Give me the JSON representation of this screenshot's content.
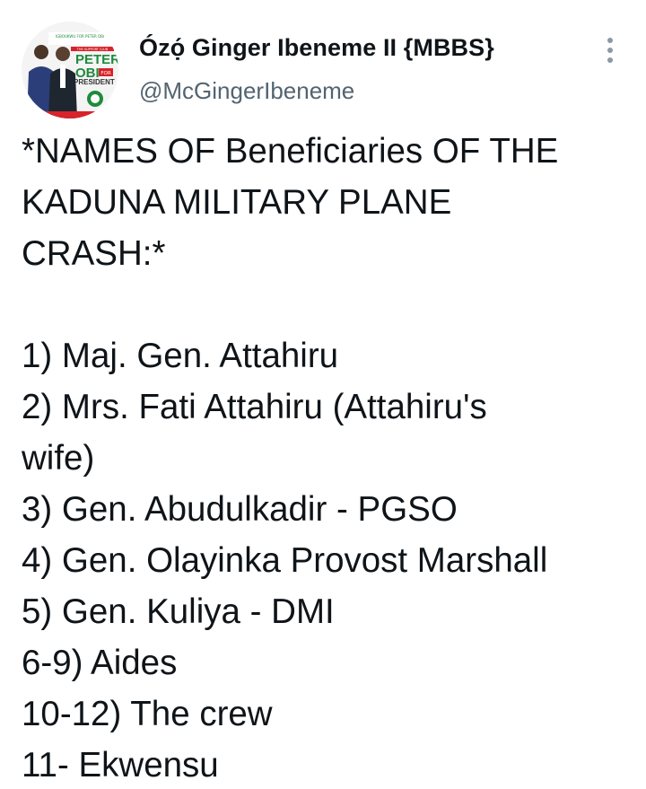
{
  "author": {
    "display_name": "Ózọ́ Ginger Ibeneme II {MBBS}",
    "handle": "@McGingerIbeneme",
    "avatar_icon": "profile-avatar",
    "avatar_text": {
      "top": "IGBOUKWU FOR PETER OBI",
      "banner": "THE SUPPORT CLUB",
      "name1": "PETER",
      "name2": "OBI",
      "for": "FOR",
      "president": "PRESIDENT"
    }
  },
  "more_icon": "more-options-icon",
  "tweet": {
    "heading_lines": [
      "*NAMES OF Beneficiaries OF THE",
      "KADUNA MILITARY PLANE",
      "CRASH:*"
    ],
    "list_lines": [
      "1) Maj. Gen. Attahiru",
      "2) Mrs. Fati Attahiru (Attahiru's",
      "wife)",
      "3) Gen. Abudulkadir - PGSO",
      "4) Gen. Olayinka Provost Marshall",
      "5) Gen. Kuliya - DMI",
      "6-9) Aides",
      "10-12) The crew",
      "11- Ekwensu"
    ]
  },
  "colors": {
    "text": "#0f1419",
    "secondary": "#536471",
    "more_dots": "#8b98a5",
    "avatar_red": "#d8232a",
    "avatar_green": "#1f8a3c"
  }
}
